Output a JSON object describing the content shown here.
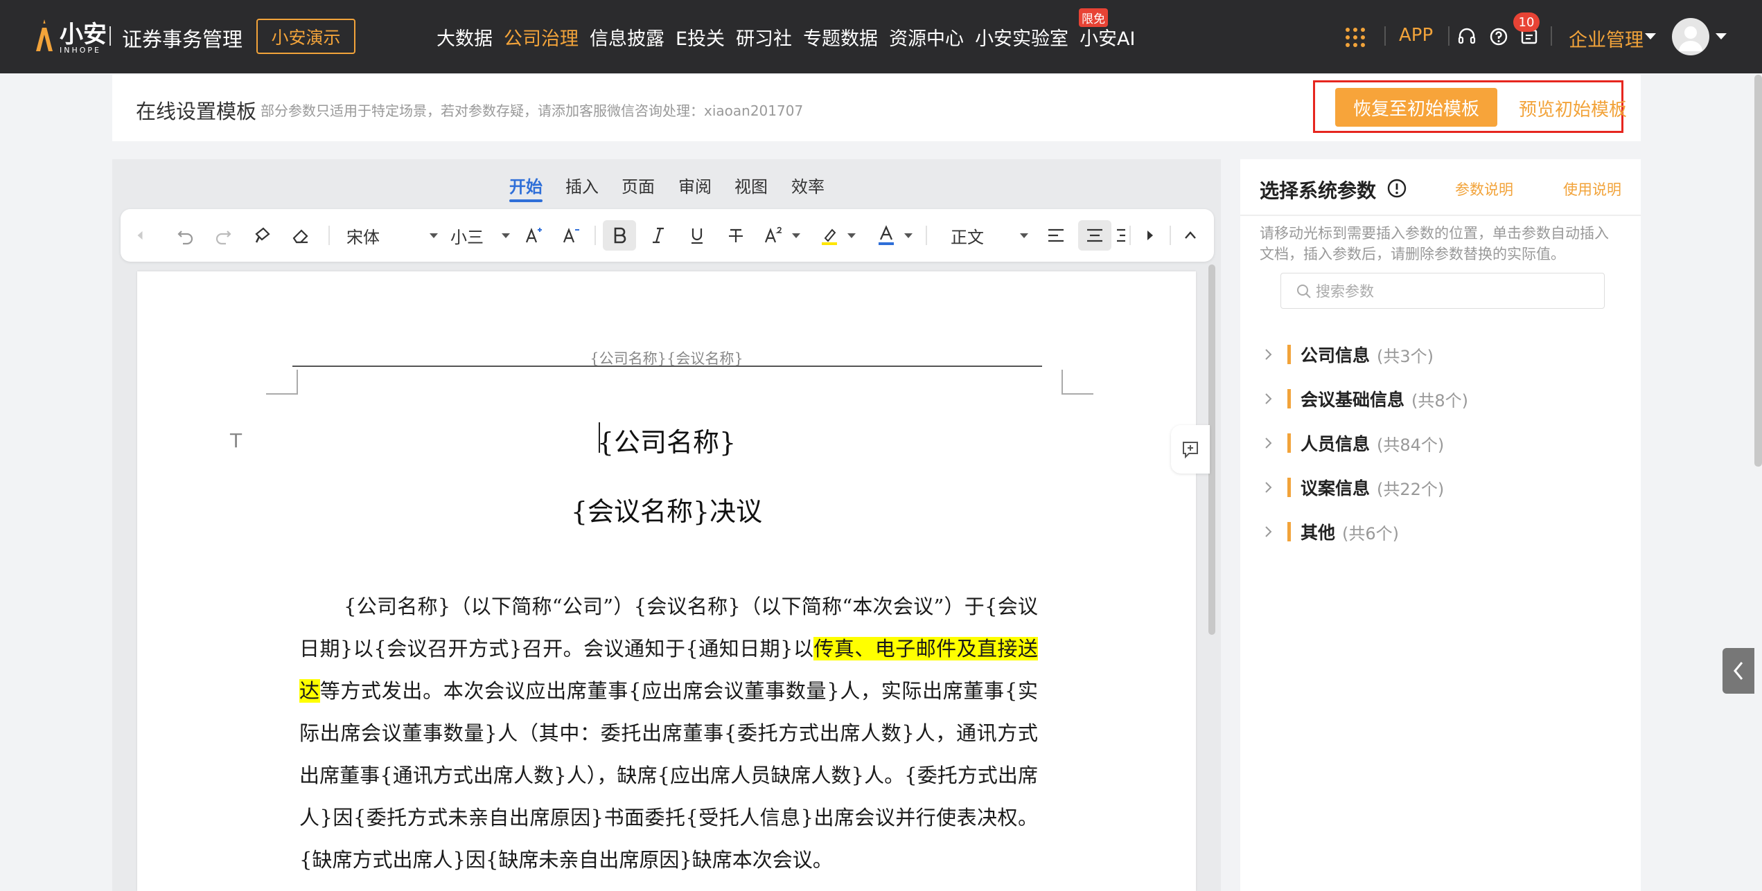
{
  "topbar": {
    "logo_text": "小安",
    "logo_sub": "INHOPE",
    "brand_title": "证券事务管理",
    "demo_button": "小安演示",
    "nav": [
      {
        "label": "大数据",
        "active": false
      },
      {
        "label": "公司治理",
        "active": true
      },
      {
        "label": "信息披露",
        "active": false
      },
      {
        "label": "E投关",
        "active": false
      },
      {
        "label": "研习社",
        "active": false
      },
      {
        "label": "专题数据",
        "active": false
      },
      {
        "label": "资源中心",
        "active": false
      },
      {
        "label": "小安实验室",
        "active": false
      },
      {
        "label": "小安AI",
        "active": false
      }
    ],
    "nav_badge": "限免",
    "app_link": "APP",
    "notification_count": "10",
    "enterprise_menu": "企业管理",
    "accent_color": "#f2a33a"
  },
  "settings": {
    "title": "在线设置模板",
    "hint": "部分参数只适用于特定场景，若对参数存疑，请添加客服微信咨询处理：xiaoan201707",
    "restore_button": "恢复至初始模板",
    "preview_link": "预览初始模板"
  },
  "editor": {
    "tabs": [
      "开始",
      "插入",
      "页面",
      "审阅",
      "视图",
      "效率"
    ],
    "active_tab": "开始",
    "toolbar": {
      "font_family": "宋体",
      "font_size": "小三",
      "paragraph_style": "正文"
    },
    "document": {
      "header": "{公司名称}{会议名称}",
      "title_line1": "{公司名称}",
      "title_line2": "{会议名称}决议",
      "para_part1": "{公司名称}（以下简称“公司”）{会议名称}（以下简称“本次会议”）于{会议日期}以{会议召开方式}召开。会议通知于{通知日期}以",
      "para_highlight": "传真、电子邮件及直接送达",
      "para_part2": "等方式发出。本次会议应出席董事{应出席会议董事数量}人，实际出席董事{实际出席会议董事数量}人（其中：委托出席董事{委托方式出席人数}人，通讯方式出席董事{通讯方式出席人数}人），缺席{应出席人员缺席人数}人。{委托方式出席人}因{委托方式未亲自出席原因}书面委托{受托人信息}出席会议并行使表决权。{缺席方式出席人}因{缺席未亲自出席原因}缺席本次会议。"
    }
  },
  "params": {
    "title": "选择系统参数",
    "link_params": "参数说明",
    "link_usage": "使用说明",
    "hint": "请移动光标到需要插入参数的位置，单击参数自动插入文档，插入参数后，请删除参数替换的实际值。",
    "search_placeholder": "搜索参数",
    "categories": [
      {
        "label": "公司信息",
        "count": "(共3个)"
      },
      {
        "label": "会议基础信息",
        "count": "(共8个)"
      },
      {
        "label": "人员信息",
        "count": "(共84个)"
      },
      {
        "label": "议案信息",
        "count": "(共22个)"
      },
      {
        "label": "其他",
        "count": "(共6个)"
      }
    ]
  }
}
